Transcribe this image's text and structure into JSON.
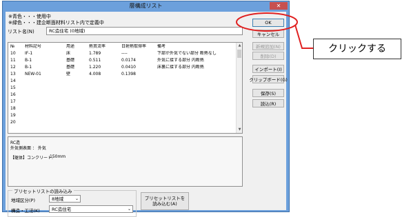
{
  "window": {
    "title": "層構成リスト",
    "close_glyph": "✕"
  },
  "legend": {
    "line1": "※青色・・・使用中",
    "line2": "※緑色・・・建企断面材料リスト内で定義中"
  },
  "list_name": {
    "label": "リスト名(N)",
    "value": "RC造住宅 (0地域)"
  },
  "table": {
    "headers": [
      "№",
      "材料記号",
      "用途",
      "熱貫流率",
      "日射熱取得率",
      "備考"
    ],
    "rows": [
      [
        "10",
        "IF-1",
        "床",
        "1.789",
        "----",
        "下部が外気でない部分 断熱なし"
      ],
      [
        "11",
        "B-1",
        "基礎",
        "0.511",
        "0.0174",
        "外気に接する部分 内断熱"
      ],
      [
        "12",
        "B-1",
        "基礎",
        "1.220",
        "0.0410",
        "床裏に接する部分 内断熱"
      ],
      [
        "13",
        "NEW-01",
        "壁",
        "4.008",
        "0.1398",
        ""
      ],
      [
        "14",
        "",
        "",
        "",
        "",
        ""
      ],
      [
        "15",
        "",
        "",
        "",
        "",
        ""
      ],
      [
        "16",
        "",
        "",
        "",
        "",
        ""
      ],
      [
        "17",
        "",
        "",
        "",
        "",
        ""
      ],
      [
        "18",
        "",
        "",
        "",
        "",
        ""
      ],
      [
        "19",
        "",
        "",
        "",
        "",
        ""
      ],
      [
        "20",
        "",
        "",
        "",
        "",
        ""
      ]
    ]
  },
  "detail": {
    "line1": "RC造",
    "line2": "外気側表面 ： 外気",
    "line3_label": "【躯体】コンクリート:",
    "line3_value": "150mm"
  },
  "buttons": {
    "ok": "OK",
    "cancel": "キャンセル",
    "new_add": "新規追加(N)",
    "delete": "削除(D)",
    "import": "インポート(I)",
    "clipboard": "クリップボード(G)",
    "save": "保存(S)",
    "load": "読込(R)"
  },
  "preset": {
    "title": "プリセットリストの読み込み",
    "region_label": "地域区分(P)",
    "region_value": "8地域",
    "structure_label": "構造・工法(K)",
    "structure_value": "RC造住宅",
    "load_button": "プリセットリストを\n読み込む(A)"
  },
  "annotation": {
    "text": "クリックする",
    "color": "#e02020"
  }
}
